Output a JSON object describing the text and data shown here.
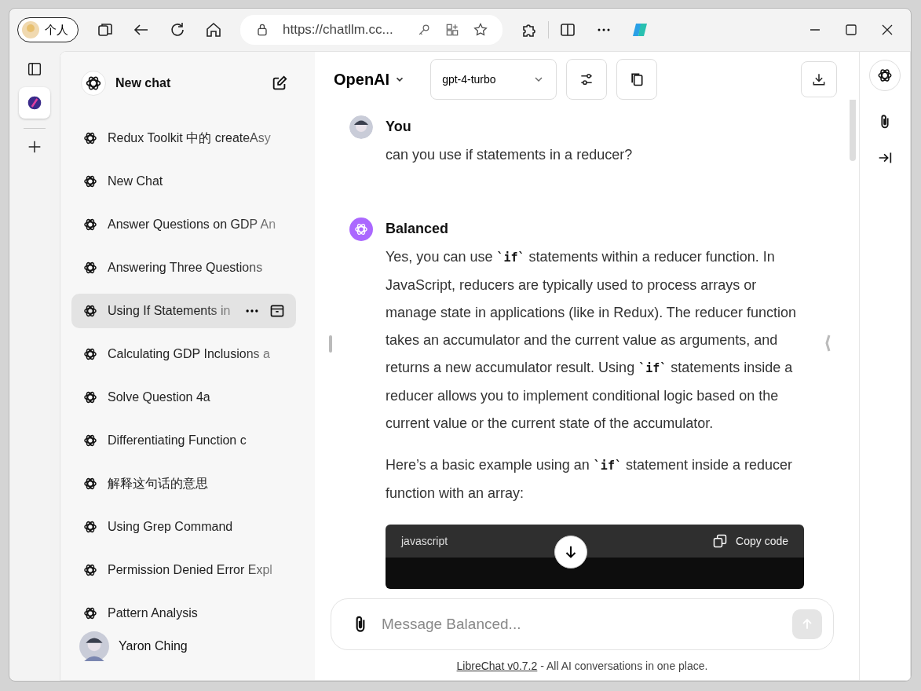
{
  "browser": {
    "profile": "个人",
    "url": "https://chatllm.cc..."
  },
  "sidebar": {
    "new_chat": "New chat",
    "items": [
      {
        "title": "Redux Toolkit 中的 createAsy",
        "selected": false
      },
      {
        "title": "New Chat",
        "selected": false
      },
      {
        "title": "Answer Questions on GDP An",
        "selected": false
      },
      {
        "title": "Answering Three Questions",
        "selected": false
      },
      {
        "title": "Using If Statements in",
        "selected": true
      },
      {
        "title": "Calculating GDP Inclusions a",
        "selected": false
      },
      {
        "title": "Solve Question 4a",
        "selected": false
      },
      {
        "title": "Differentiating Function c",
        "selected": false
      },
      {
        "title": "解释这句话的意思",
        "selected": false
      },
      {
        "title": "Using Grep Command",
        "selected": false
      },
      {
        "title": "Permission Denied Error Expl",
        "selected": false
      },
      {
        "title": "Pattern Analysis",
        "selected": false
      }
    ],
    "user": "Yaron Ching"
  },
  "header": {
    "endpoint": "OpenAI",
    "model": "gpt-4-turbo"
  },
  "messages": [
    {
      "kind": "user",
      "sender": "You",
      "paragraphs": [
        [
          {
            "kind": "text",
            "text": "can you use if statements in a reducer?"
          }
        ]
      ]
    },
    {
      "kind": "assistant",
      "sender": "Balanced",
      "paragraphs": [
        [
          {
            "kind": "text",
            "text": "Yes, you can use "
          },
          {
            "kind": "code",
            "text": "`if`"
          },
          {
            "kind": "text",
            "text": " statements within a reducer function. In JavaScript, reducers are typically used to process arrays or manage state in applications (like in Redux). The reducer function takes an accumulator and the current value as arguments, and returns a new accumulator result. Using "
          },
          {
            "kind": "code",
            "text": "`if`"
          },
          {
            "kind": "text",
            "text": " statements inside a reducer allows you to implement conditional logic based on the current value or the current state of the accumulator."
          }
        ],
        [
          {
            "kind": "text",
            "text": "Here’s a basic example using an "
          },
          {
            "kind": "code",
            "text": "`if`"
          },
          {
            "kind": "text",
            "text": " statement inside a reducer function with an array:"
          }
        ]
      ],
      "code": {
        "language": "javascript",
        "copy": "Copy code"
      }
    }
  ],
  "composer": {
    "placeholder": "Message Balanced..."
  },
  "footer": {
    "link": "LibreChat v0.7.2",
    "text": " - All AI conversations in one place."
  }
}
